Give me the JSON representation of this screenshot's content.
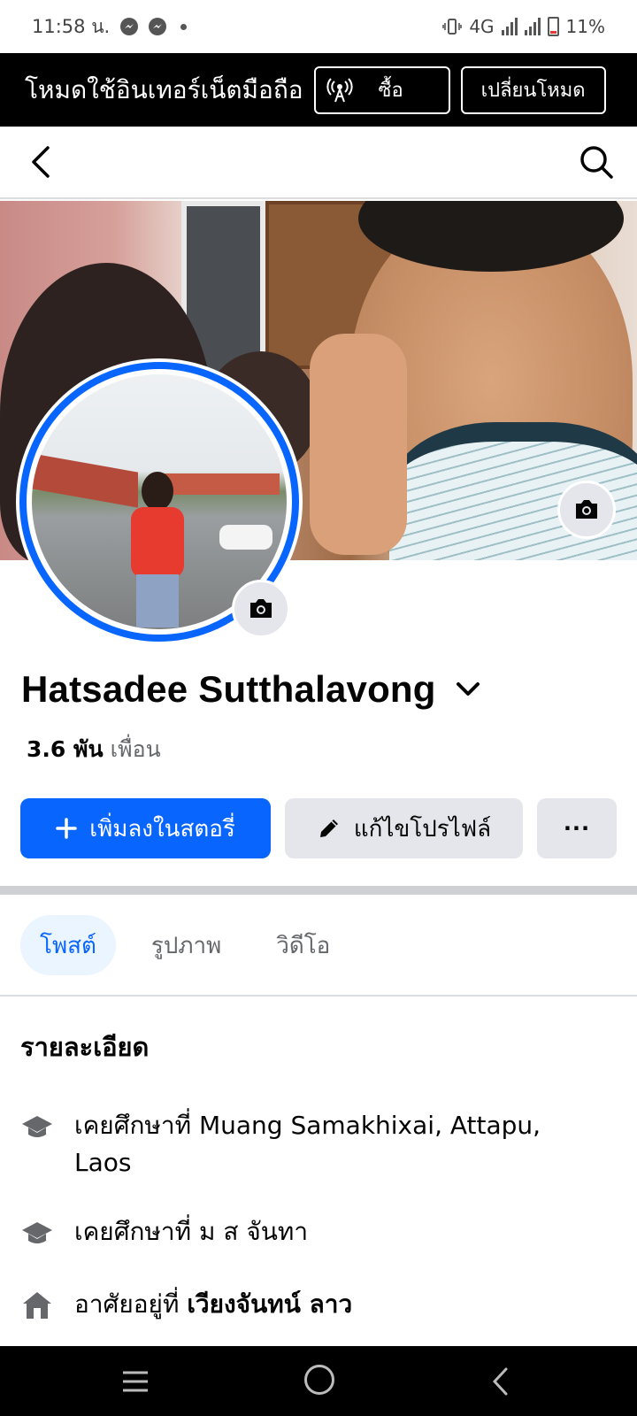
{
  "status_bar": {
    "time": "11:58 น.",
    "network": "4G",
    "battery": "11%"
  },
  "data_banner": {
    "text": "โหมดใช้อินเทอร์เน็ตมือถือ",
    "buy_label": "ซื้อ",
    "switch_label": "เปลี่ยนโหมด"
  },
  "profile": {
    "name": "Hatsadee Sutthalavong",
    "friends_count": "3.6 พัน",
    "friends_label": "เพื่อน"
  },
  "actions": {
    "add_story": "เพิ่มลงในสตอรี่",
    "edit_profile": "แก้ไขโปรไฟล์",
    "more": "···"
  },
  "tabs": [
    {
      "label": "โพสต์",
      "active": true
    },
    {
      "label": "รูปภาพ",
      "active": false
    },
    {
      "label": "วิดีโอ",
      "active": false
    }
  ],
  "details": {
    "title": "รายละเอียด",
    "items": [
      {
        "icon": "graduation-cap-icon",
        "text": "เคยศึกษาที่ Muang Samakhixai, Attapu, Laos"
      },
      {
        "icon": "graduation-cap-icon",
        "text": "เคยศึกษาที่ ม ส จันทา"
      },
      {
        "icon": "home-icon",
        "prefix": "อาศัยอยู่ที่ ",
        "place": "เวียงจันทน์ ลาว"
      }
    ]
  },
  "colors": {
    "accent": "#0866ff",
    "banner_bg": "#000000",
    "secondary_button": "#e4e6eb"
  }
}
